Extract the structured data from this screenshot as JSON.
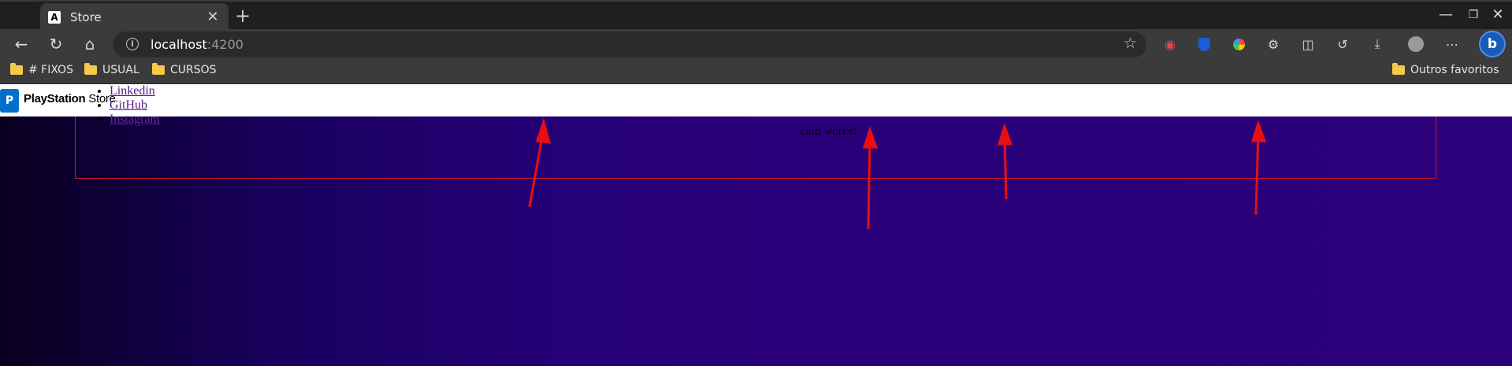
{
  "browser": {
    "tab": {
      "favicon": "angular-icon",
      "favicon_letter": "A",
      "title": "Store",
      "close": "✕"
    },
    "new_tab": "+",
    "window_controls": {
      "minimize": "—",
      "restore": "❐",
      "close": "✕"
    },
    "toolbar": {
      "back": "←",
      "reload": "↻",
      "home": "⌂",
      "url_host": "localhost",
      "url_port": ":4200",
      "favorite_star": "☆",
      "extensions": [
        "reader-icon",
        "bitwarden-icon",
        "color-icon",
        "puzzle-icon",
        "split-icon",
        "history-icon",
        "download-icon",
        "profile-icon",
        "more-icon"
      ],
      "copilot_label": "b"
    },
    "bookmarks": [
      {
        "label": "# FIXOS"
      },
      {
        "label": "USUAL"
      },
      {
        "label": "CURSOS"
      }
    ],
    "other_favorites": "Outros favoritos"
  },
  "page": {
    "brand_bold": "PlayStation",
    "brand_light": "Store",
    "nav_links": [
      "Linkedin",
      "GitHub",
      "Instagram"
    ],
    "card_text": "card works!",
    "annotation_color": "#e80f0f"
  }
}
